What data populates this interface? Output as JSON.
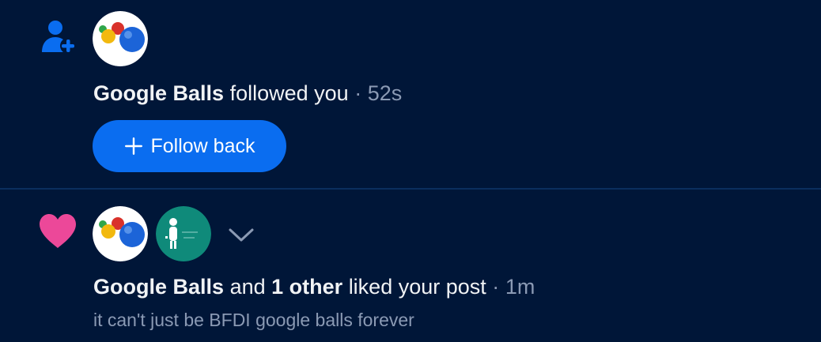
{
  "notifications": [
    {
      "type_icon": "person-add-icon",
      "actor": "Google Balls",
      "action": "followed you",
      "separator": "·",
      "time": "52s",
      "button_label": "Follow back"
    },
    {
      "type_icon": "heart-icon",
      "actor": "Google Balls",
      "connector": "and",
      "others": "1 other",
      "action": "liked your post",
      "separator": "·",
      "time": "1m",
      "post_text": "it can't just be BFDI google balls forever",
      "expand_icon": "chevron-down-icon"
    }
  ],
  "colors": {
    "background": "#001638",
    "accent_blue": "#0a6df0",
    "heart_pink": "#ec4899",
    "avatar_teal": "#0f8a7a",
    "muted_text": "#8b9ab4"
  }
}
